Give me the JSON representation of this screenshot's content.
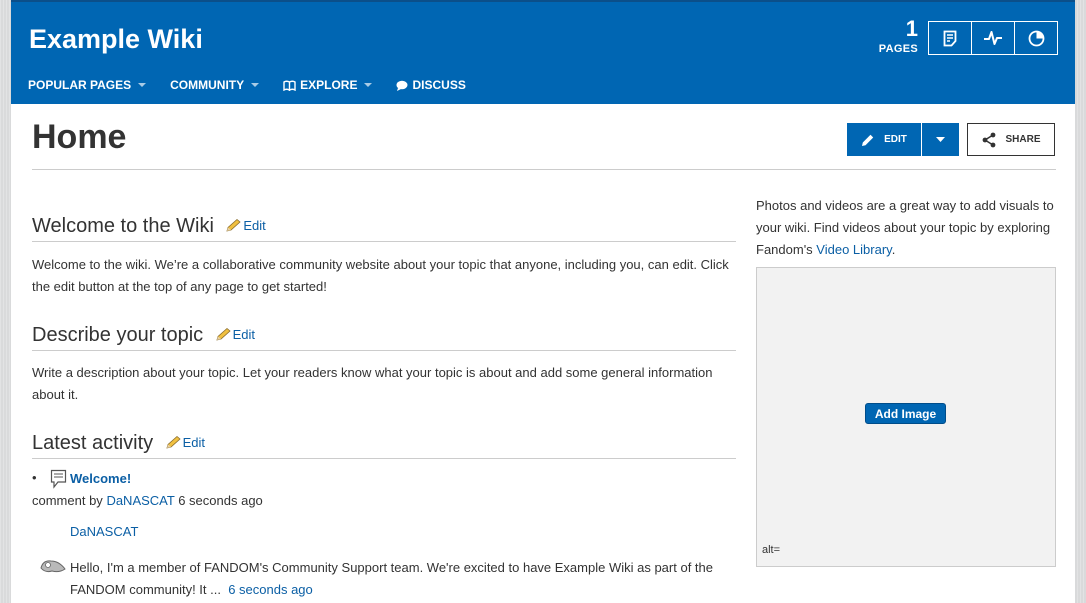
{
  "header": {
    "wiki_name": "Example Wiki",
    "pages_count": "1",
    "pages_label": "PAGES",
    "nav": [
      {
        "label": "POPULAR PAGES"
      },
      {
        "label": "COMMUNITY"
      },
      {
        "label": "EXPLORE"
      },
      {
        "label": "DISCUSS"
      }
    ],
    "tools": [
      "page-icon",
      "activity-icon",
      "insights-icon"
    ]
  },
  "page": {
    "title": "Home",
    "edit_label": "EDIT",
    "share_label": "SHARE"
  },
  "content": {
    "sections": [
      {
        "title": "Welcome to the Wiki",
        "edit": "Edit",
        "text": "Welcome to the wiki. We’re a collaborative community website about your topic that anyone, including you, can edit. Click the edit button at the top of any page to get started!"
      },
      {
        "title": "Describe your topic",
        "edit": "Edit",
        "text": "Write a description about your topic. Let your readers know what your topic is about and add some general information about it."
      },
      {
        "title": "Latest activity",
        "edit": "Edit"
      }
    ],
    "activity": {
      "bullet": "•",
      "title": "Welcome!",
      "meta_prefix": "comment by",
      "user": "DaNASCAT",
      "time": "6 seconds ago",
      "author": "DaNASCAT",
      "comment": "Hello, I'm a member of FANDOM's Community Support team. We're excited to have Example Wiki as part of the FANDOM community! It ...",
      "comment_time": "6 seconds ago"
    }
  },
  "rail": {
    "text": "Photos and videos are a great way to add visuals to your wiki. Find videos about your topic by exploring Fandom's",
    "link": "Video Library",
    "after": ".",
    "add_image": "Add Image",
    "alt": "alt="
  },
  "colors": {
    "brand": "#0066b3",
    "link": "#0b5fa5"
  }
}
